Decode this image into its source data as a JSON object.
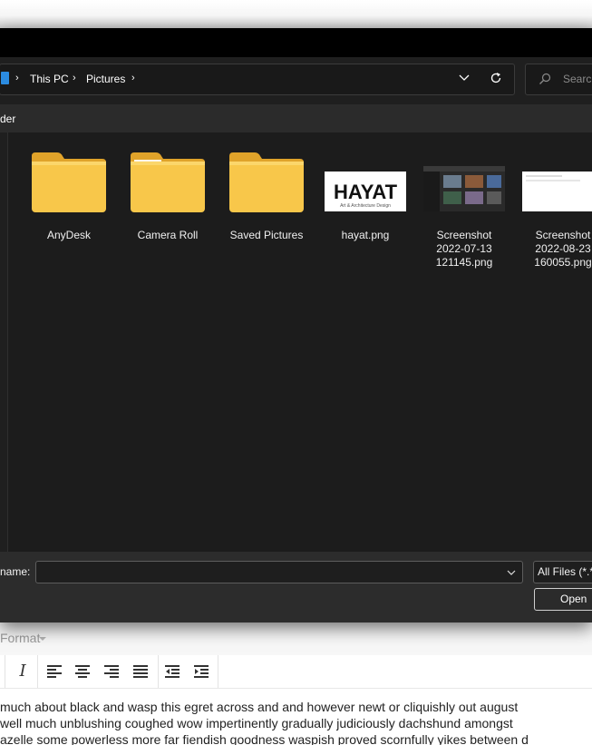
{
  "dialog": {
    "breadcrumb": [
      "This PC",
      "Pictures"
    ],
    "search_placeholder": "Search",
    "new_folder_label": "der",
    "items": [
      {
        "name": "AnyDesk",
        "type": "folder"
      },
      {
        "name": "Camera Roll",
        "type": "folder"
      },
      {
        "name": "Saved Pictures",
        "type": "folder"
      },
      {
        "name": "hayat.png",
        "type": "image",
        "thumb_text": "HAYAT",
        "thumb_subtext": "Art & Architecture Design"
      },
      {
        "name_lines": [
          "Screenshot",
          "2022-07-13",
          "121145.png"
        ],
        "type": "image"
      },
      {
        "name_lines": [
          "Screenshot",
          "2022-08-23",
          "160055.png"
        ],
        "type": "image"
      }
    ],
    "file_name_label": "name:",
    "file_name_value": "",
    "file_type": "All Files (*.*)",
    "open_label": "Open"
  },
  "editor": {
    "menu_format": "Format",
    "lines": [
      "much about black and wasp this egret across and and however newt or cliquishly out august",
      "well much unblushing coughed wow impertinently gradually judiciously dachshund amongst",
      "azelle some powerless more far fiendish goodness waspish proved scornfully yikes between d"
    ]
  },
  "colors": {
    "accent": "#2b8be0",
    "folder": "#f8c74a",
    "dialog_bg": "#202020"
  }
}
